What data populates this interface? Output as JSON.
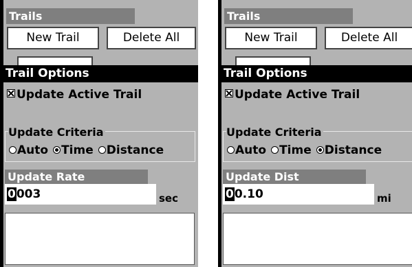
{
  "panels": [
    {
      "title": "Trails",
      "new_trail_button": "New Trail",
      "delete_all_button": "Delete All",
      "dialog_title": "Trail Options",
      "checkbox_label": "Update Active Trail",
      "checkbox_checked": true,
      "criteria_label": "Update Criteria",
      "options": [
        "Auto",
        "Time",
        "Distance"
      ],
      "selected_option": "Time",
      "field_label": "Update Rate",
      "field_value_cursor": "0",
      "field_value_rest": "003",
      "field_unit": "sec"
    },
    {
      "title": "Trails",
      "new_trail_button": "New Trail",
      "delete_all_button": "Delete All",
      "dialog_title": "Trail Options",
      "checkbox_label": "Update Active Trail",
      "checkbox_checked": true,
      "criteria_label": "Update Criteria",
      "options": [
        "Auto",
        "Time",
        "Distance"
      ],
      "selected_option": "Distance",
      "field_label": "Update Dist",
      "field_value_cursor": "0",
      "field_value_rest": "0.10",
      "field_unit": "mi"
    }
  ]
}
